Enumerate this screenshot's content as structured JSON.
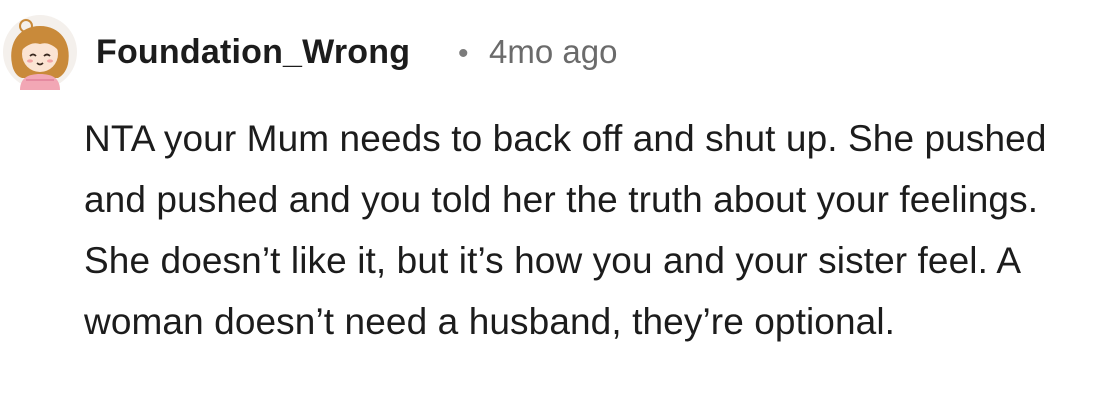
{
  "comment": {
    "username": "Foundation_Wrong",
    "separator": "•",
    "timestamp": "4mo ago",
    "avatar_icon": "avatar-icon",
    "body": "NTA your Mum needs to back off and shut up. She pushed and pushed and you told her the truth about your feelings. She doesn’t like it, but it’s how you and your sister feel. A woman doesn’t need a husband, they’re optional."
  },
  "colors": {
    "text": "#1c1c1c",
    "muted": "#6b6b6b",
    "background": "#ffffff",
    "avatar_hair": "#c98a3a",
    "avatar_shirt": "#f2a7b5"
  }
}
